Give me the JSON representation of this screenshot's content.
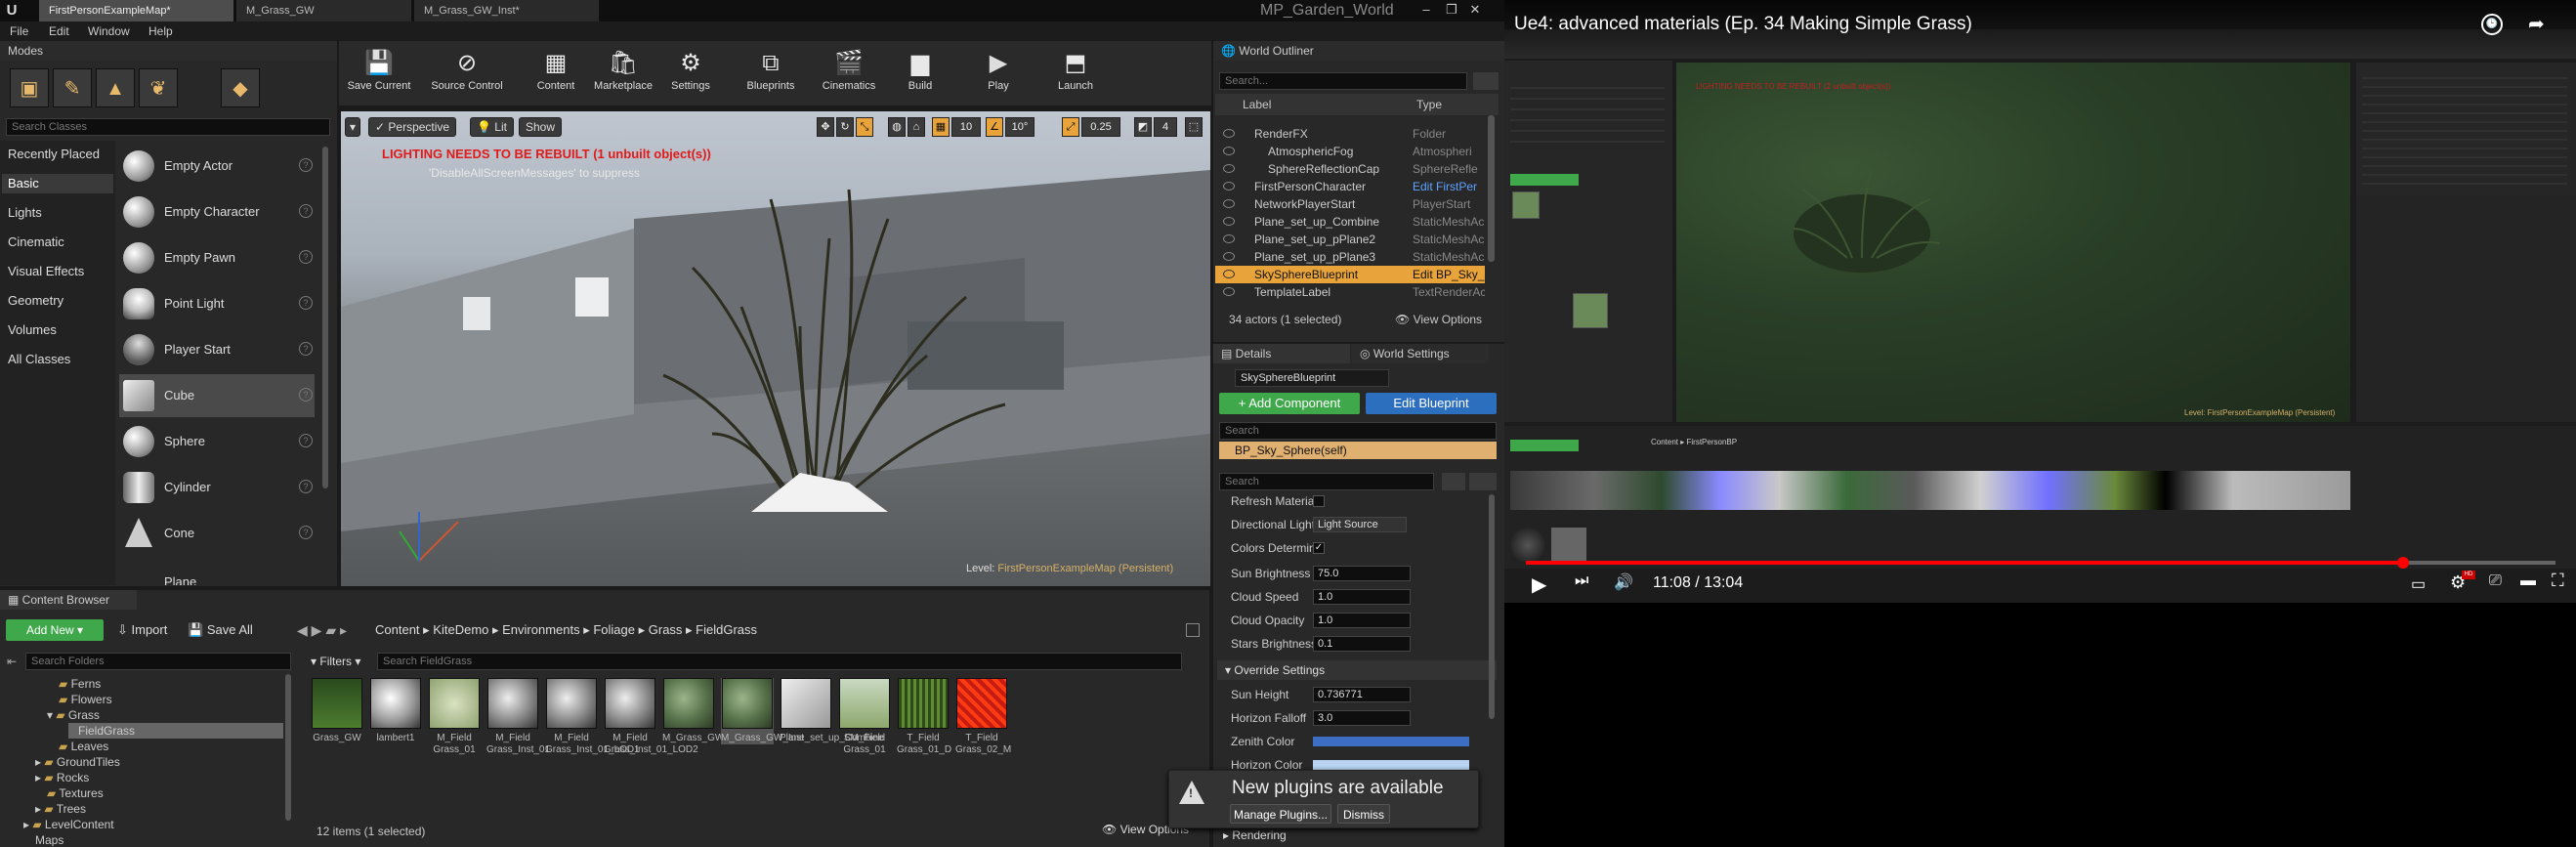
{
  "titlebar": {
    "tabs": [
      "FirstPersonExampleMap*",
      "M_Grass_GW",
      "M_Grass_GW_Inst*"
    ],
    "project": "MP_Garden_World"
  },
  "menu": [
    "File",
    "Edit",
    "Window",
    "Help"
  ],
  "modes": {
    "title": "Modes",
    "search_placeholder": "Search Classes",
    "categories": [
      "Recently Placed",
      "Basic",
      "Lights",
      "Cinematic",
      "Visual Effects",
      "Geometry",
      "Volumes",
      "All Classes"
    ],
    "items": [
      "Empty Actor",
      "Empty Character",
      "Empty Pawn",
      "Point Light",
      "Player Start",
      "Cube",
      "Sphere",
      "Cylinder",
      "Cone",
      "Plane"
    ]
  },
  "toolbar": [
    "Save Current",
    "Source Control",
    "Content",
    "Marketplace",
    "Settings",
    "Blueprints",
    "Cinematics",
    "Build",
    "Play",
    "Launch"
  ],
  "viewport": {
    "perspective": "Perspective",
    "lit": "Lit",
    "show": "Show",
    "grid_snap": "10",
    "rot_snap": "10°",
    "scale_snap": "0.25",
    "camera_speed": "4",
    "warning": "LIGHTING NEEDS TO BE REBUILT (1 unbuilt object(s))",
    "warning_sub": "'DisableAllScreenMessages' to suppress",
    "level_label": "Level:",
    "level_name": "FirstPersonExampleMap (Persistent)"
  },
  "outliner": {
    "title": "World Outliner",
    "search_placeholder": "Search...",
    "col_label": "Label",
    "col_type": "Type",
    "rows": [
      {
        "label": "RenderFX",
        "type": "Folder"
      },
      {
        "label": "AtmosphericFog",
        "type": "Atmospheri"
      },
      {
        "label": "SphereReflectionCap",
        "type": "SphereRefle"
      },
      {
        "label": "FirstPersonCharacter",
        "type": "Edit FirstPer"
      },
      {
        "label": "NetworkPlayerStart",
        "type": "PlayerStart"
      },
      {
        "label": "Plane_set_up_Combine",
        "type": "StaticMeshAc"
      },
      {
        "label": "Plane_set_up_pPlane2",
        "type": "StaticMeshAc"
      },
      {
        "label": "Plane_set_up_pPlane3",
        "type": "StaticMeshAc"
      },
      {
        "label": "SkySphereBlueprint",
        "type": "Edit BP_Sky_"
      },
      {
        "label": "TemplateLabel",
        "type": "TextRenderAc"
      }
    ],
    "count": "34 actors (1 selected)",
    "view_options": "View Options"
  },
  "details": {
    "tab_details": "Details",
    "tab_world": "World Settings",
    "actor_name": "SkySphereBlueprint",
    "add_component": "+ Add Component",
    "edit_blueprint": "Edit Blueprint",
    "search_placeholder": "Search",
    "component": "BP_Sky_Sphere(self)",
    "props": [
      {
        "label": "Refresh Materia",
        "value": ""
      },
      {
        "label": "Directional Light",
        "value": "Light Source"
      },
      {
        "label": "Colors Determin",
        "value": ""
      },
      {
        "label": "Sun Brightness",
        "value": "75.0"
      },
      {
        "label": "Cloud Speed",
        "value": "1.0"
      },
      {
        "label": "Cloud Opacity",
        "value": "1.0"
      },
      {
        "label": "Stars Brightness",
        "value": "0.1"
      }
    ],
    "override_title": "Override Settings",
    "override_props": [
      {
        "label": "Sun Height",
        "value": "0.736771"
      },
      {
        "label": "Horizon Falloff",
        "value": "3.0"
      },
      {
        "label": "Zenith Color",
        "value": ""
      },
      {
        "label": "Horizon Color",
        "value": ""
      }
    ],
    "rendering": "Rendering"
  },
  "content_browser": {
    "title": "Content Browser",
    "add_new": "Add New",
    "import": "Import",
    "save_all": "Save All",
    "path": [
      "Content",
      "KiteDemo",
      "Environments",
      "Foliage",
      "Grass",
      "FieldGrass"
    ],
    "folder_search": "Search Folders",
    "filters": "Filters",
    "asset_search": "Search FieldGrass",
    "folders": [
      "Ferns",
      "Flowers",
      "Grass",
      "FieldGrass",
      "Leaves",
      "GroundTiles",
      "Rocks",
      "Textures",
      "Trees",
      "LevelContent",
      "Maps"
    ],
    "assets": [
      "Grass_GW",
      "lambert1",
      "M_Field Grass_01",
      "M_Field Grass_Inst_01",
      "M_Field Grass_Inst_01_LOD1",
      "M_Field Grass_Inst_01_LOD2",
      "M_Grass_GW",
      "M_Grass_GW_Inst",
      "Plane_set_up_Combine",
      "SM_Field Grass_01",
      "T_Field Grass_01_D",
      "T_Field Grass_02_M"
    ],
    "count": "12 items (1 selected)",
    "view_options": "View Options"
  },
  "notification": {
    "text": "New plugins are available",
    "manage": "Manage Plugins...",
    "dismiss": "Dismiss"
  },
  "youtube": {
    "title": "Ue4: advanced materials (Ep. 34 Making Simple Grass)",
    "time": "11:08 / 13:04",
    "progress": 0.852,
    "inner_path": [
      "Content",
      "FirstPersonBP"
    ],
    "inner_level": "Level: FirstPersonExampleMap (Persistent)",
    "inner_warning": "LIGHTING NEEDS TO BE REBUILT (2 unbuilt object(s))"
  },
  "colors": {
    "accent": "#e8a33a",
    "green": "#3fa84a",
    "blue": "#2d6fbf",
    "red": "#ff0000"
  }
}
